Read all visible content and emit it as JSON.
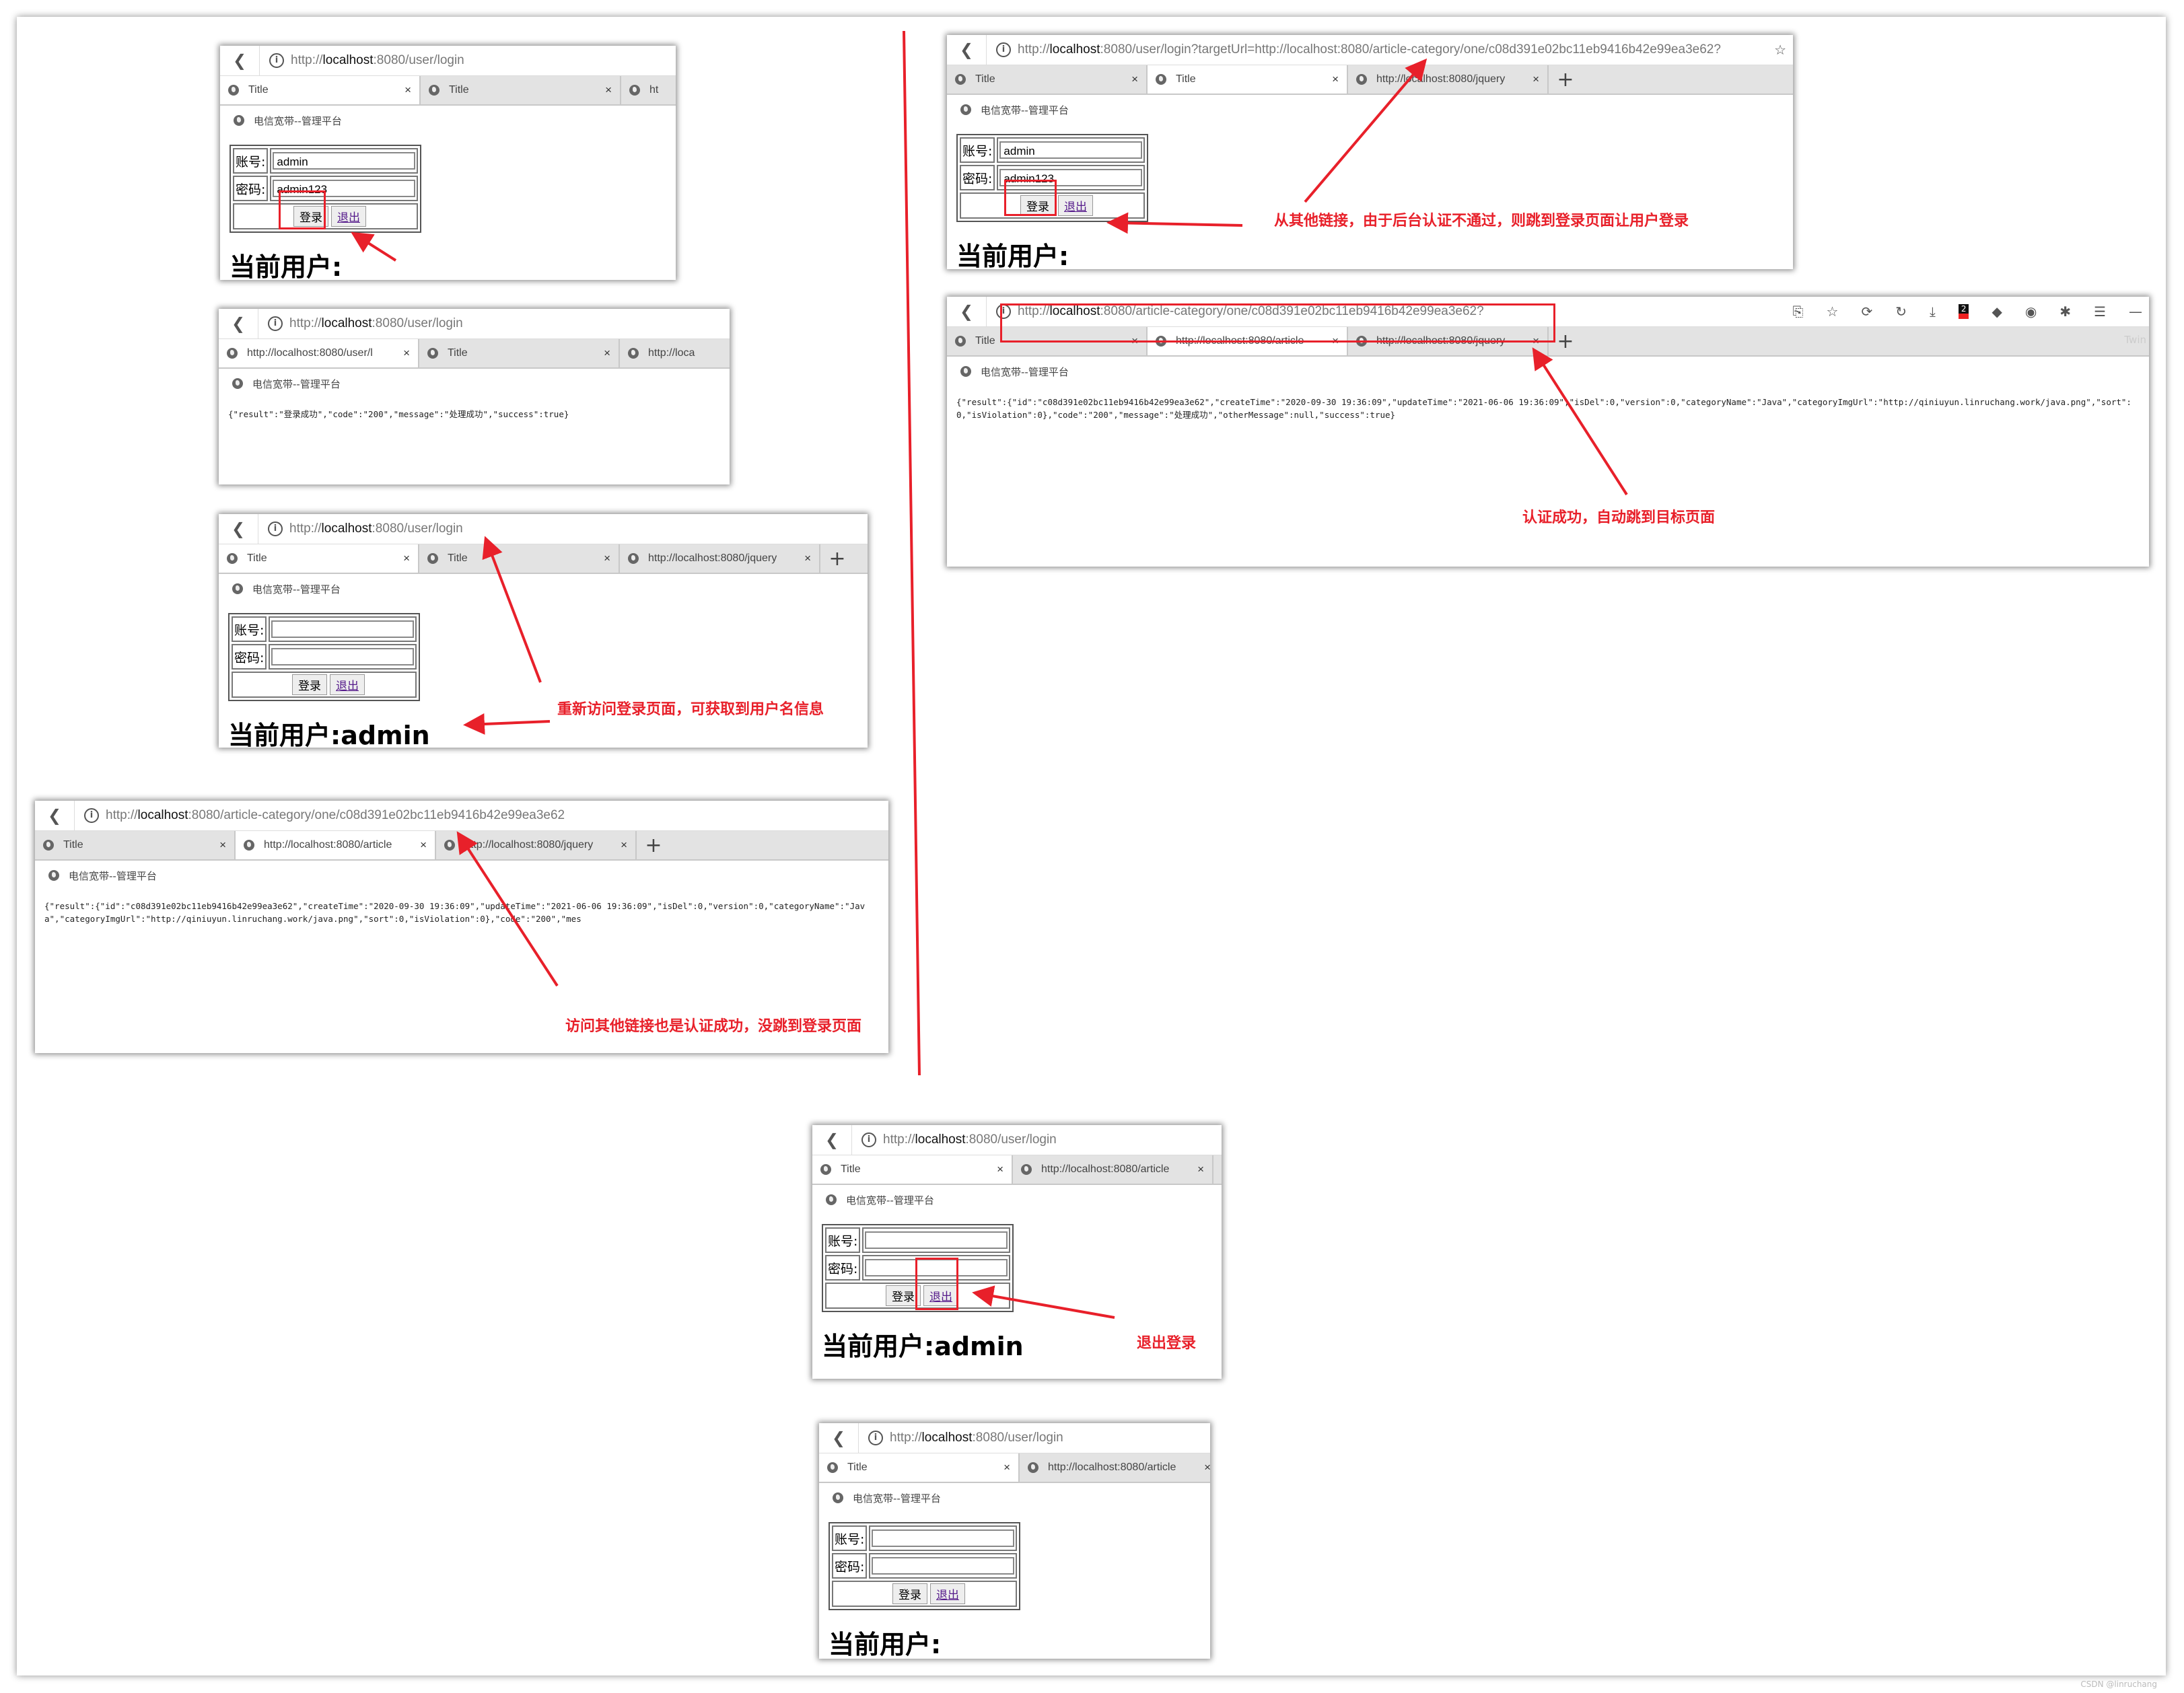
{
  "bookmark_label": "电信宽带--管理平台",
  "form_labels": {
    "account": "账号:",
    "password": "密码:",
    "login": "登录",
    "logout": "退出",
    "current_user": "当前用户:"
  },
  "windows": [
    {
      "url": {
        "scheme": "http://",
        "host": "localhost",
        "rest": ":8080/user/login"
      },
      "tabs": [
        {
          "label": "Title",
          "active": true,
          "close": "×"
        },
        {
          "label": "Title",
          "active": false,
          "close": "×"
        },
        {
          "label": "ht",
          "active": false,
          "close": ""
        }
      ],
      "type": "login",
      "account": "admin",
      "password": "admin123",
      "user": ""
    },
    {
      "url": {
        "scheme": "http://",
        "host": "localhost",
        "rest": ":8080/user/login"
      },
      "tabs": [
        {
          "label": "http://localhost:8080/user/l",
          "active": true,
          "close": "×"
        },
        {
          "label": "Title",
          "active": false,
          "close": "×"
        },
        {
          "label": "http://loca",
          "active": false,
          "close": ""
        }
      ],
      "type": "json",
      "json": "{\"result\":\"登录成功\",\"code\":\"200\",\"message\":\"处理成功\",\"success\":true}"
    },
    {
      "url": {
        "scheme": "http://",
        "host": "localhost",
        "rest": ":8080/user/login"
      },
      "tabs": [
        {
          "label": "Title",
          "active": true,
          "close": "×"
        },
        {
          "label": "Title",
          "active": false,
          "close": "×"
        },
        {
          "label": "http://localhost:8080/jquery",
          "active": false,
          "close": "×"
        }
      ],
      "plus": "+",
      "type": "login",
      "account": "",
      "password": "",
      "user": "admin"
    },
    {
      "url": {
        "scheme": "http://",
        "host": "localhost",
        "rest": ":8080/article-category/one/c08d391e02bc11eb9416b42e99ea3e62"
      },
      "tabs": [
        {
          "label": "Title",
          "active": false,
          "close": "×"
        },
        {
          "label": "http://localhost:8080/article",
          "active": true,
          "close": "×"
        },
        {
          "label": "http://localhost:8080/jquery",
          "active": false,
          "close": "×"
        }
      ],
      "plus": "+",
      "type": "json",
      "json": "{\"result\":{\"id\":\"c08d391e02bc11eb9416b42e99ea3e62\",\"createTime\":\"2020-09-30 19:36:09\",\"updateTime\":\"2021-06-06 19:36:09\",\"isDel\":0,\"version\":0,\"categoryName\":\"Java\",\"categoryImgUrl\":\"http://qiniuyun.linruchang.work/java.png\",\"sort\":0,\"isViolation\":0},\"code\":\"200\",\"mes"
    },
    {
      "url": {
        "scheme": "http://",
        "host": "localhost",
        "rest": ":8080/user/login?targetUrl=http://localhost:8080/article-category/one/c08d391e02bc11eb9416b42e99ea3e62?"
      },
      "tabs": [
        {
          "label": "Title",
          "active": false,
          "close": "×"
        },
        {
          "label": "Title",
          "active": true,
          "close": "×"
        },
        {
          "label": "http://localhost:8080/jquery",
          "active": false,
          "close": "×"
        }
      ],
      "plus": "+",
      "tools": [
        {
          "icon": "star-icon",
          "glyph": "☆"
        }
      ],
      "type": "login",
      "account": "admin",
      "password": "admin123",
      "user": ""
    },
    {
      "url": {
        "scheme": "http://",
        "host": "localhost",
        "rest": ":8080/article-category/one/c08d391e02bc11eb9416b42e99ea3e62?"
      },
      "tabs": [
        {
          "label": "Title",
          "active": false,
          "close": "×"
        },
        {
          "label": "http://localhost:8080/article",
          "active": true,
          "close": "×"
        },
        {
          "label": "http://localhost:8080/jquery",
          "active": false,
          "close": "×"
        }
      ],
      "plus": "+",
      "twin": "Twin",
      "tools": [
        {
          "icon": "translate-icon",
          "glyph": "⎘"
        },
        {
          "icon": "star-icon",
          "glyph": "☆"
        },
        {
          "icon": "sync-icon",
          "glyph": "⟳"
        },
        {
          "icon": "undo-icon",
          "glyph": "↻"
        },
        {
          "icon": "download-icon",
          "glyph": "⤓"
        },
        {
          "icon": "extension-badge-icon",
          "glyph": "2",
          "badge": true
        },
        {
          "icon": "shield-extension-icon",
          "glyph": "◆"
        },
        {
          "icon": "globe-extension-icon",
          "glyph": "◉"
        },
        {
          "icon": "puzzle-icon",
          "glyph": "✱"
        },
        {
          "icon": "menu-icon",
          "glyph": "☰"
        },
        {
          "icon": "minimize-icon",
          "glyph": "—"
        }
      ],
      "type": "json",
      "json": "{\"result\":{\"id\":\"c08d391e02bc11eb9416b42e99ea3e62\",\"createTime\":\"2020-09-30 19:36:09\",\"updateTime\":\"2021-06-06 19:36:09\",\"isDel\":0,\"version\":0,\"categoryName\":\"Java\",\"categoryImgUrl\":\"http://qiniuyun.linruchang.work/java.png\",\"sort\":0,\"isViolation\":0},\"code\":\"200\",\"message\":\"处理成功\",\"otherMessage\":null,\"success\":true}"
    },
    {
      "url": {
        "scheme": "http://",
        "host": "localhost",
        "rest": ":8080/user/login"
      },
      "tabs": [
        {
          "label": "Title",
          "active": true,
          "close": "×"
        },
        {
          "label": "http://localhost:8080/article",
          "active": false,
          "close": "×"
        }
      ],
      "type": "login",
      "account": "",
      "password": "",
      "user": "admin"
    },
    {
      "url": {
        "scheme": "http://",
        "host": "localhost",
        "rest": ":8080/user/login"
      },
      "tabs": [
        {
          "label": "Title",
          "active": true,
          "close": "×"
        },
        {
          "label": "http://localhost:8080/article",
          "active": false,
          "close": "×"
        }
      ],
      "type": "login",
      "account": "",
      "password": "",
      "user": ""
    }
  ],
  "annotations": {
    "redirect_login": "从其他链接，由于后台认证不通过，则跳到登录页面让用户登录",
    "auth_success": "认证成功，自动跳到目标页面",
    "revisit_login": "重新访问登录页面，可获取到用户名信息",
    "other_link": "访问其他链接也是认证成功，没跳到登录页面",
    "logout": "退出登录"
  },
  "colors": {
    "annotation": "#e8202a"
  },
  "watermark": "CSDN @linruchang"
}
